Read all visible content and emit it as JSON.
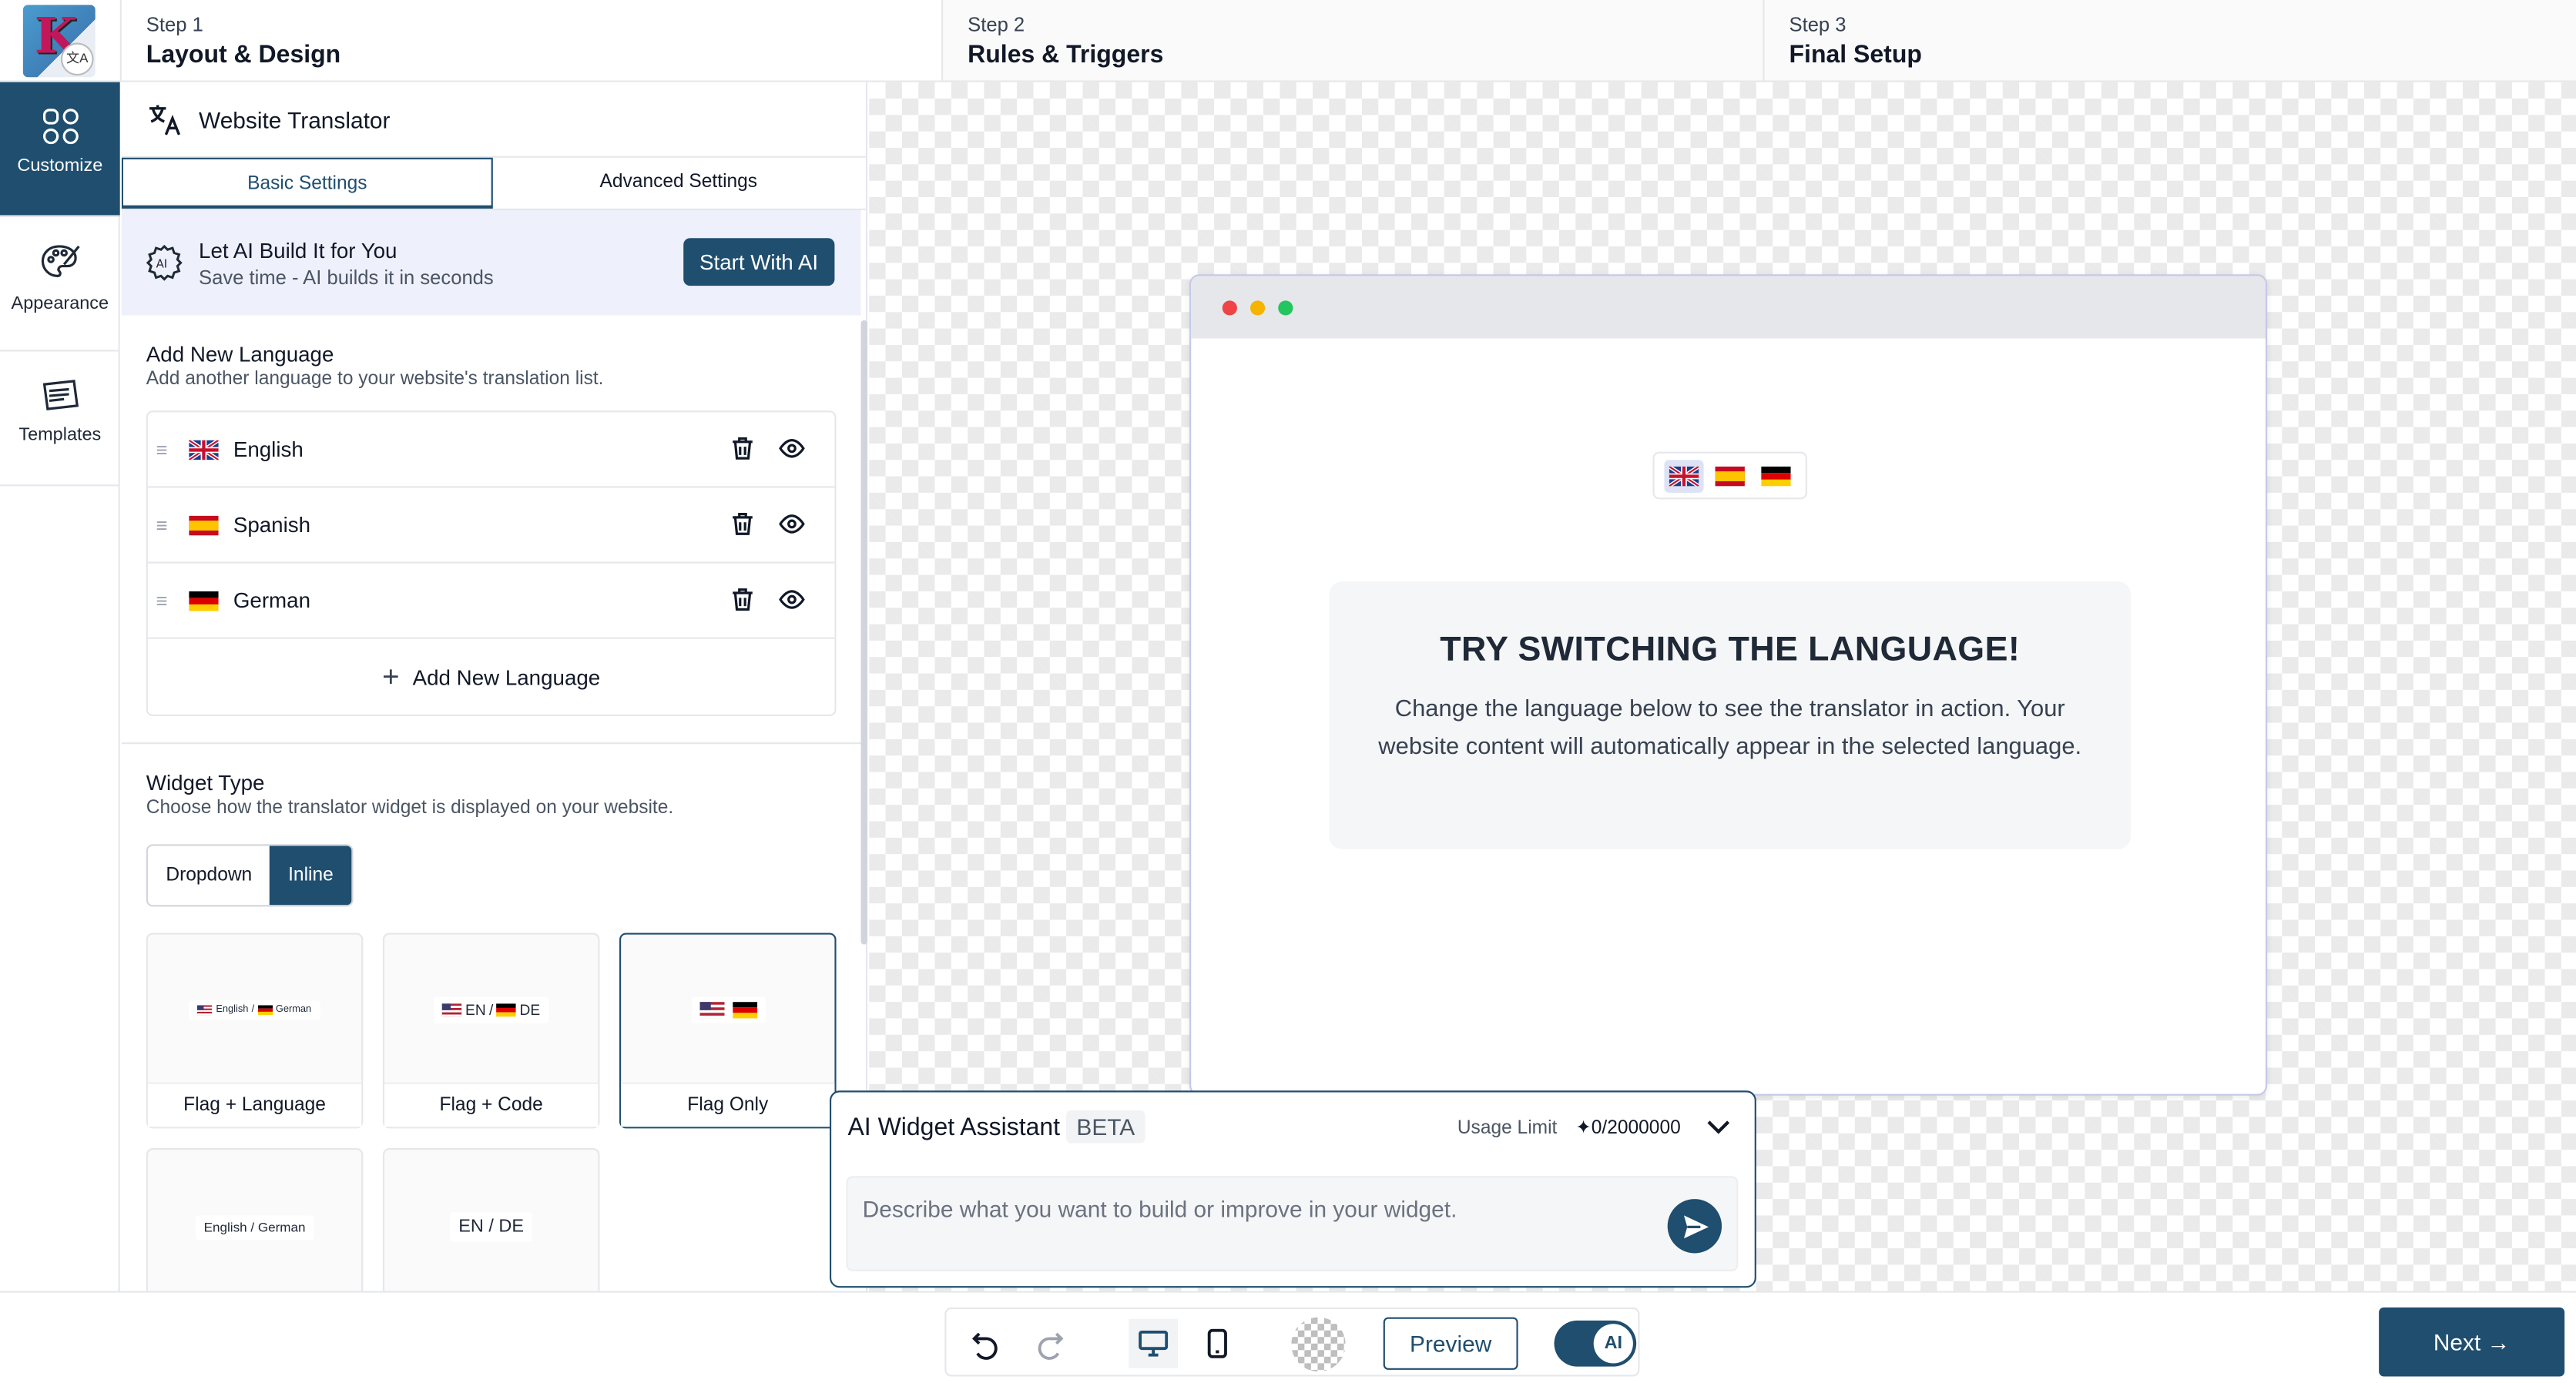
{
  "app": {
    "logo_letter": "K",
    "logo_badge": "文A"
  },
  "steps": [
    {
      "num": "Step 1",
      "name": "Layout & Design"
    },
    {
      "num": "Step 2",
      "name": "Rules & Triggers"
    },
    {
      "num": "Step 3",
      "name": "Final Setup"
    }
  ],
  "rail": [
    {
      "label": "Customize",
      "icon": "grid-icon",
      "active": true
    },
    {
      "label": "Appearance",
      "icon": "palette-icon",
      "active": false
    },
    {
      "label": "Templates",
      "icon": "templates-icon",
      "active": false
    }
  ],
  "panel": {
    "title": "Website Translator",
    "tabs": [
      "Basic Settings",
      "Advanced Settings"
    ],
    "active_tab": "Basic Settings",
    "ai_banner": {
      "title": "Let AI Build It for You",
      "subtitle": "Save time - AI builds it in seconds",
      "button": "Start With AI"
    },
    "add_language": {
      "title": "Add New Language",
      "subtitle": "Add another language to your website's translation list.",
      "languages": [
        "English",
        "Spanish",
        "German"
      ],
      "add_button": "Add New Language"
    },
    "widget_type": {
      "title": "Widget Type",
      "subtitle": "Choose how the translator widget is displayed on your website.",
      "options": [
        "Dropdown",
        "Inline"
      ],
      "selected": "Inline",
      "cards": [
        {
          "label": "Flag + Language",
          "preview": "English / German"
        },
        {
          "label": "Flag + Code",
          "preview": "EN / DE"
        },
        {
          "label": "Flag Only",
          "preview": ""
        },
        {
          "label": "",
          "preview": "English / German"
        },
        {
          "label": "",
          "preview": "EN / DE"
        }
      ],
      "card_previews": {
        "flag_language": [
          "English",
          "/",
          "German"
        ],
        "flag_code": [
          "EN",
          "/",
          "DE"
        ]
      },
      "selected_card": "Flag Only"
    }
  },
  "preview": {
    "heading": "TRY SWITCHING THE LANGUAGE!",
    "body": "Change the language below to see the translator in action. Your website content will automatically appear in the selected language."
  },
  "assistant": {
    "title": "AI Widget Assistant",
    "badge": "BETA",
    "usage_label": "Usage Limit",
    "usage_value": "0/2000000",
    "placeholder": "Describe what you want to build or improve in your widget."
  },
  "toolbar": {
    "preview": "Preview",
    "ai_toggle": "AI",
    "next": "Next →"
  },
  "colors": {
    "accent": "#1f4e6f",
    "banner_bg": "#eef0fb",
    "dot_red": "#ef4444",
    "dot_yellow": "#f5b400",
    "dot_green": "#22c55e"
  }
}
